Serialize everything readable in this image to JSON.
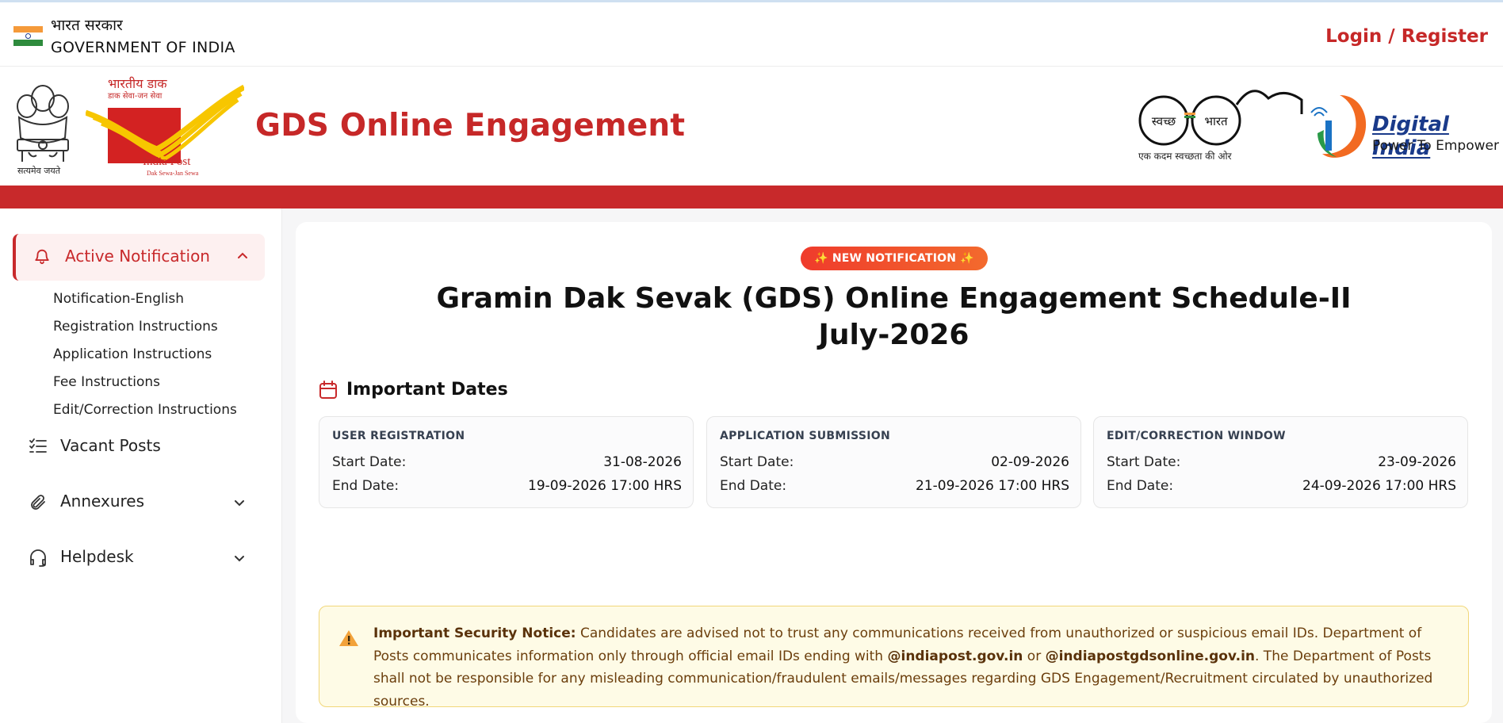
{
  "gov_bar": {
    "hindi": "भारत सरकार",
    "english": "GOVERNMENT OF INDIA",
    "login": "Login / Register"
  },
  "brand": {
    "emblem_caption": "सत्यमेव जयते",
    "india_post_hindi": "भारतीय डाक",
    "india_post_hindi_tag": "डाक सेवा-जन सेवा",
    "india_post_name": "India Post",
    "india_post_tag": "Dak Sewa-Jan Sewa",
    "title": "GDS Online Engagement",
    "swachh_left": "स्वच्छ",
    "swachh_right": "भारत",
    "swachh_caption": "एक कदम स्वच्छता की ओर",
    "digital_india": "Digital India",
    "digital_india_tag": "Power To Empower"
  },
  "sidebar": {
    "active": "Active Notification",
    "sub_items": [
      "Notification-English",
      "Registration Instructions",
      "Application Instructions",
      "Fee Instructions",
      "Edit/Correction Instructions"
    ],
    "items": [
      "Vacant Posts",
      "Annexures",
      "Helpdesk"
    ]
  },
  "main": {
    "badge": "✨ NEW NOTIFICATION ✨",
    "title_line1": "Gramin Dak Sevak (GDS) Online Engagement Schedule-II",
    "title_line2": "July-2026",
    "dates_heading": "Important Dates",
    "date_cards": [
      {
        "heading": "USER REGISTRATION",
        "start_label": "Start Date:",
        "start": "31-08-2026",
        "end_label": "End Date:",
        "end": "19-09-2026 17:00 HRS"
      },
      {
        "heading": "APPLICATION SUBMISSION",
        "start_label": "Start Date:",
        "start": "02-09-2026",
        "end_label": "End Date:",
        "end": "21-09-2026 17:00 HRS"
      },
      {
        "heading": "EDIT/CORRECTION WINDOW",
        "start_label": "Start Date:",
        "start": "23-09-2026",
        "end_label": "End Date:",
        "end": "24-09-2026 17:00 HRS"
      }
    ],
    "notice": {
      "label": "Important Security Notice:",
      "text1": " Candidates are advised not to trust any communications received from unauthorized or suspicious email IDs. Department of Posts communicates information only through official email IDs ending with ",
      "email1": "@indiapost.gov.in",
      "or": " or ",
      "email2": "@indiapostgdsonline.gov.in",
      "text2": ". The Department of Posts shall not be responsible for any misleading communication/fraudulent emails/messages regarding GDS Engagement/Recruitment circulated by unauthorized sources."
    }
  },
  "colors": {
    "brand_red": "#c8292b",
    "badge_orange": "#f36a2d",
    "notice_bg": "#fefbe6"
  }
}
